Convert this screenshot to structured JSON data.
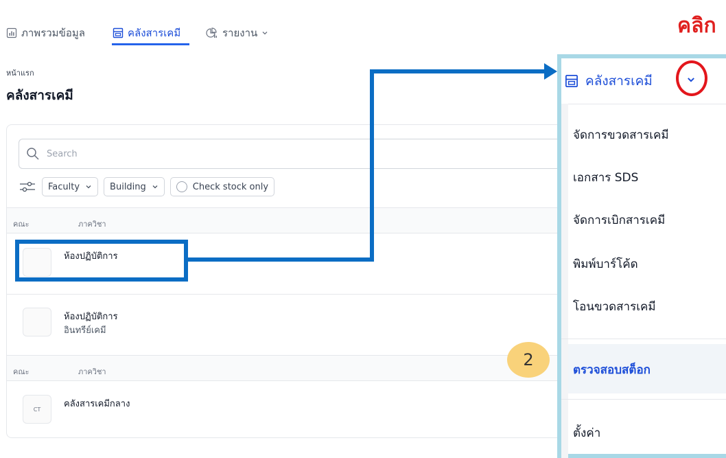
{
  "nav": {
    "items": [
      {
        "label": "ภาพรวมข้อมูล",
        "icon": "bar-chart-icon"
      },
      {
        "label": "คลังสารเคมี",
        "icon": "warehouse-icon"
      },
      {
        "label": "รายงาน",
        "icon": "report-icon"
      }
    ],
    "active_index": 1
  },
  "breadcrumb": "หน้าแรก",
  "page_title": "คลังสารเคมี",
  "search": {
    "placeholder": "Search"
  },
  "filters": {
    "faculty": "Faculty",
    "building": "Building",
    "check_stock": "Check stock only"
  },
  "groups": [
    {
      "col1": "คณะ",
      "col2": "ภาควิชา",
      "rows": [
        {
          "title": "ห้องปฏิบัติการ",
          "subtitle": "",
          "thumb": ""
        },
        {
          "title": "ห้องปฏิบัติการ",
          "subtitle": "อินทรีย์เคมี",
          "thumb": ""
        }
      ]
    },
    {
      "col1": "คณะ",
      "col2": "ภาควิชา",
      "rows": [
        {
          "title": "คลังสารเคมีกลาง",
          "subtitle": "",
          "thumb": "CT"
        }
      ]
    }
  ],
  "dropdown": {
    "title": "คลังสารเคมี",
    "items": [
      {
        "label": "จัดการขวดสารเคมี"
      },
      {
        "label": "เอกสาร SDS"
      },
      {
        "label": "จัดการเบิกสารเคมี"
      },
      {
        "label": "พิมพ์บาร์โค้ด"
      },
      {
        "label": "โอนขวดสารเคมี"
      },
      {
        "label": "ตรวจสอบสต็อก",
        "selected": true
      },
      {
        "label": "ตั้งค่า"
      }
    ]
  },
  "annotations": {
    "click_label": "คลิก",
    "step_number": "2",
    "highlight_color": "#0b6dc4",
    "circle_color": "#e3161c",
    "badge_color": "#f9d27a",
    "panel_border_color": "#a8d8e6"
  }
}
